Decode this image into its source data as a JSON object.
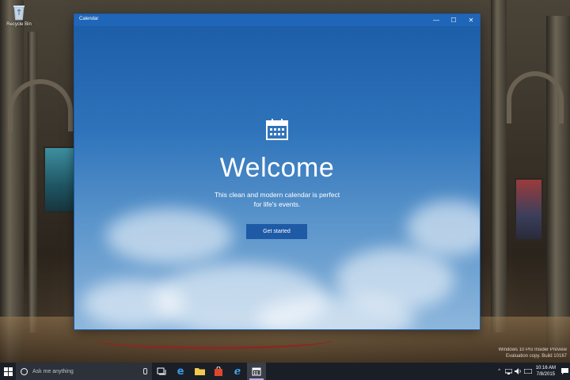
{
  "desktop": {
    "recycle_bin_label": "Recycle Bin",
    "watermark_lines": [
      "Windows 10 Pro Insider Preview",
      "Evaluation copy. Build 10167"
    ]
  },
  "window": {
    "title": "Calendar",
    "controls": {
      "minimize": "—",
      "maximize": "☐",
      "close": "✕"
    }
  },
  "app": {
    "heading": "Welcome",
    "subtitle_line1": "This clean and modern calendar is perfect",
    "subtitle_line2": "for life's events.",
    "cta_label": "Get started"
  },
  "taskbar": {
    "search_placeholder": "Ask me anything",
    "clock_time": "10:16 AM",
    "clock_date": "7/8/2015"
  },
  "colors": {
    "accent": "#1f66b8",
    "button": "#1e5aa6",
    "taskbar": "#1a1f27"
  }
}
